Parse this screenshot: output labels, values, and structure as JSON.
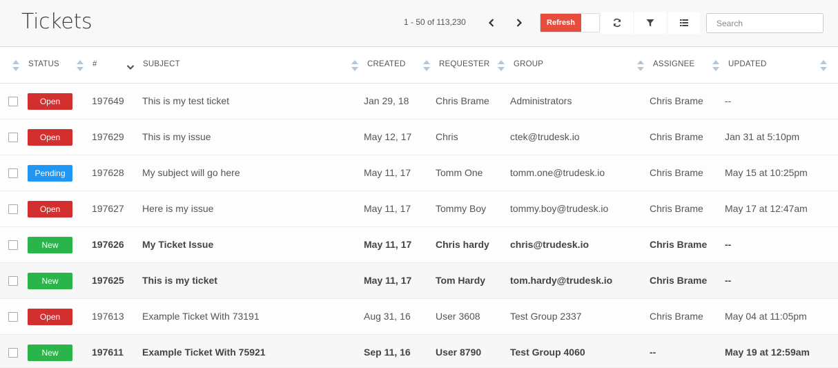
{
  "header": {
    "title": "Tickets",
    "pager_text": "1 - 50 of 113,230",
    "refresh_label": "Refresh",
    "search_placeholder": "Search",
    "icons": {
      "prev": "chevron-left-icon",
      "next": "chevron-right-icon",
      "reload": "reload-icon",
      "filter": "filter-icon",
      "menu": "list-menu-icon"
    }
  },
  "colors": {
    "open": "#d32f2f",
    "pending": "#2196f3",
    "new": "#29b54a",
    "refresh": "#e74c3c"
  },
  "columns": {
    "status": "STATUS",
    "number": "#",
    "subject": "SUBJECT",
    "created": "CREATED",
    "requester": "REQUESTER",
    "group": "GROUP",
    "assignee": "ASSIGNEE",
    "updated": "UPDATED"
  },
  "rows": [
    {
      "status": "Open",
      "number": "197649",
      "subject": "This is my test ticket",
      "created": "Jan 29, 18",
      "requester": "Chris Brame",
      "group": "Administrators",
      "assignee": "Chris Brame",
      "updated": "--"
    },
    {
      "status": "Open",
      "number": "197629",
      "subject": "This is my issue",
      "created": "May 12, 17",
      "requester": "Chris",
      "group": "ctek@trudesk.io",
      "assignee": "Chris Brame",
      "updated": "Jan 31 at 5:10pm"
    },
    {
      "status": "Pending",
      "number": "197628",
      "subject": "My subject will go here",
      "created": "May 11, 17",
      "requester": "Tomm One",
      "group": "tomm.one@trudesk.io",
      "assignee": "Chris Brame",
      "updated": "May 15 at 10:25pm"
    },
    {
      "status": "Open",
      "number": "197627",
      "subject": "Here is my issue",
      "created": "May 11, 17",
      "requester": "Tommy Boy",
      "group": "tommy.boy@trudesk.io",
      "assignee": "Chris Brame",
      "updated": "May 17 at 12:47am"
    },
    {
      "status": "New",
      "number": "197626",
      "subject": "My Ticket Issue",
      "created": "May 11, 17",
      "requester": "Chris hardy",
      "group": "chris@trudesk.io",
      "assignee": "Chris Brame",
      "updated": "--"
    },
    {
      "status": "New",
      "number": "197625",
      "subject": "This is my ticket",
      "created": "May 11, 17",
      "requester": "Tom Hardy",
      "group": "tom.hardy@trudesk.io",
      "assignee": "Chris Brame",
      "updated": "--"
    },
    {
      "status": "Open",
      "number": "197613",
      "subject": "Example Ticket With 73191",
      "created": "Aug 31, 16",
      "requester": "User 3608",
      "group": "Test Group 2337",
      "assignee": "Chris Brame",
      "updated": "May 04 at 11:05pm"
    },
    {
      "status": "New",
      "number": "197611",
      "subject": "Example Ticket With 75921",
      "created": "Sep 11, 16",
      "requester": "User 8790",
      "group": "Test Group 4060",
      "assignee": "--",
      "updated": "May 19 at 12:59am"
    }
  ]
}
